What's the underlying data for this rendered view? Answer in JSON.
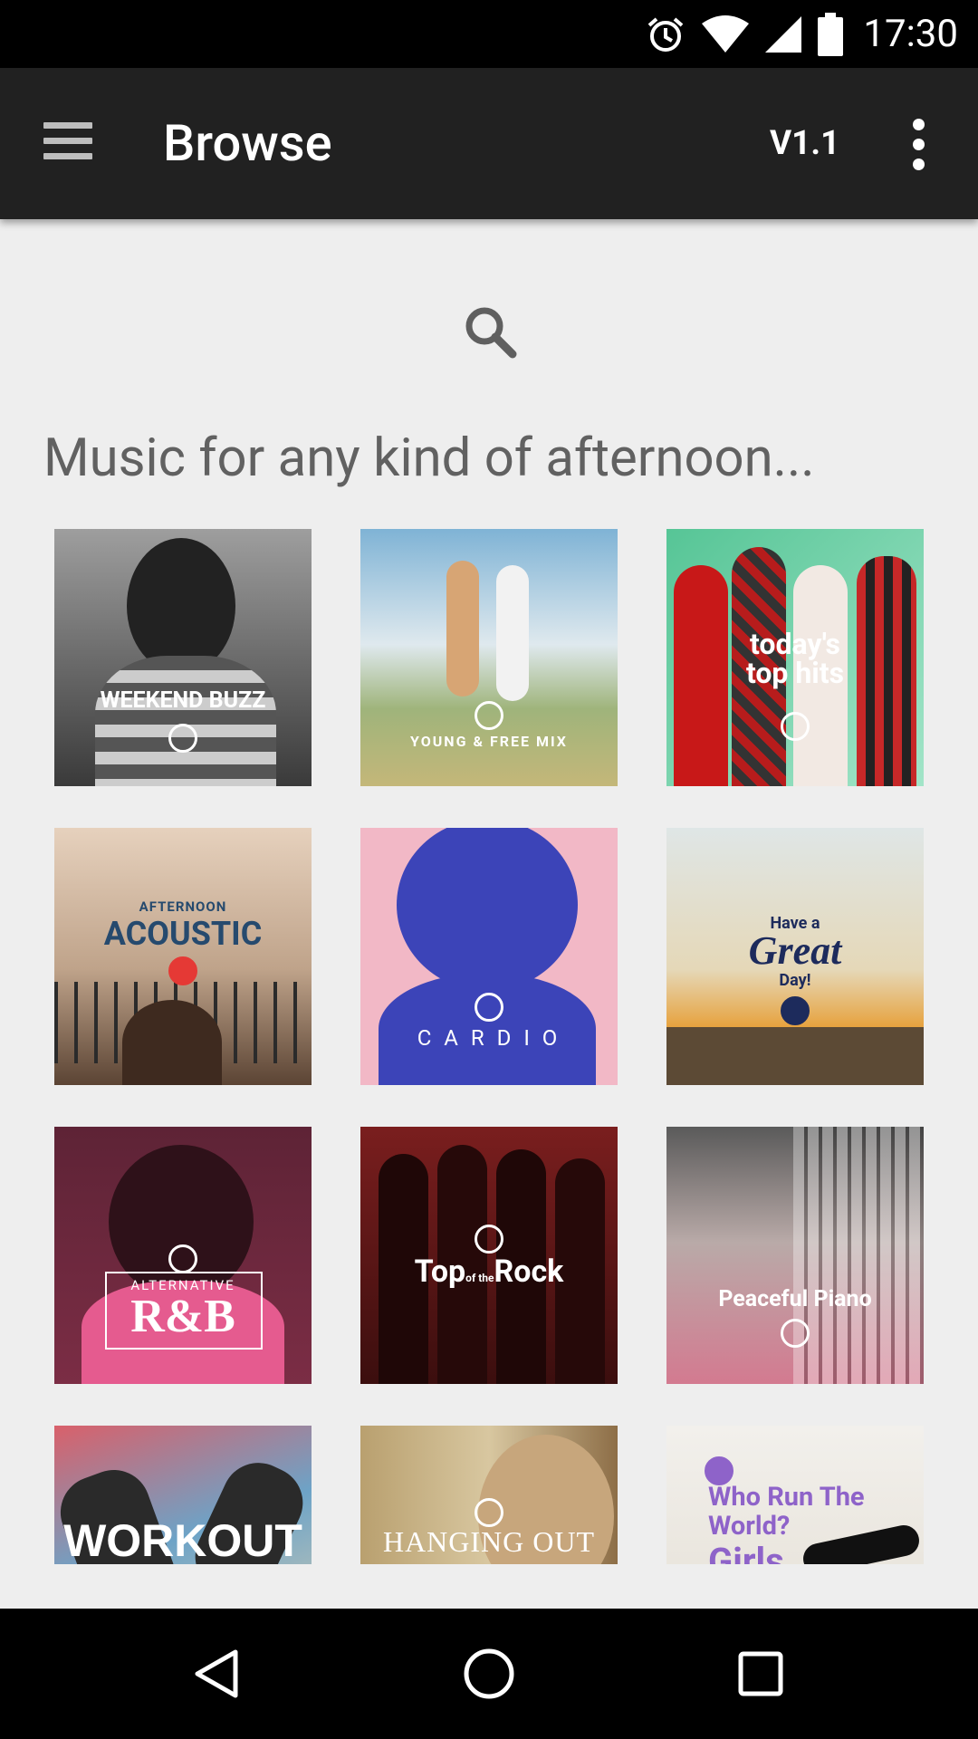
{
  "status_bar": {
    "time": "17:30",
    "icons": [
      "alarm-icon",
      "wifi-icon",
      "signal-icon",
      "battery-icon"
    ]
  },
  "app_bar": {
    "title": "Browse",
    "version": "V1.1",
    "menu_icon": "menu-icon",
    "overflow_icon": "more-vert-icon"
  },
  "search": {
    "icon": "search-icon"
  },
  "section": {
    "heading": "Music for any kind of afternoon..."
  },
  "playlists": [
    {
      "title": "WEEKEND BUZZ"
    },
    {
      "title": "YOUNG & FREE MIX"
    },
    {
      "title_line1": "today's",
      "title_line2": "top hits"
    },
    {
      "kicker": "AFTERNOON",
      "title": "ACOUSTIC"
    },
    {
      "title": "C A R D I O"
    },
    {
      "line1": "Have a",
      "line2": "Great",
      "line3": "Day!"
    },
    {
      "kicker": "ALTERNATIVE",
      "title": "R&B"
    },
    {
      "prefix": "Top",
      "mid": "of the",
      "suffix": "Rock"
    },
    {
      "title": "Peaceful Piano"
    },
    {
      "title": "WORKOUT"
    },
    {
      "title": "HANGING OUT"
    },
    {
      "line1": "Who Run The",
      "line2": "World?",
      "line3": "Girls"
    }
  ],
  "colors": {
    "app_bar": "#212121",
    "background": "#eeeeee",
    "heading": "#616161",
    "status_bar": "#000000"
  },
  "nav_bar": {
    "back_icon": "back-triangle-icon",
    "home_icon": "home-circle-icon",
    "recents_icon": "recents-square-icon"
  }
}
